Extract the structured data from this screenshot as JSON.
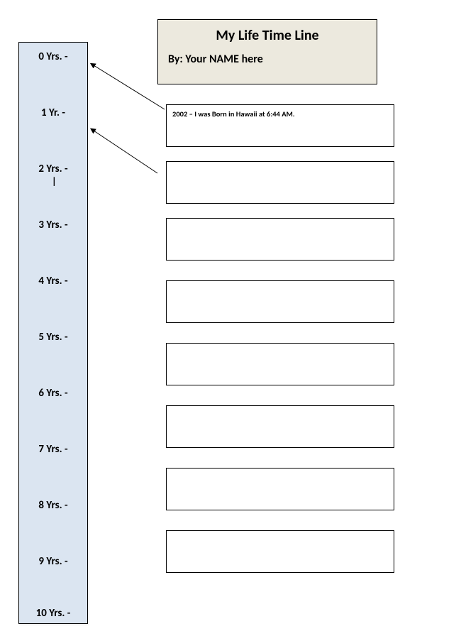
{
  "title": "My Life Time Line",
  "byline": "By:  Your NAME here",
  "years": {
    "y0": "0 Yrs. -",
    "y1": "1 Yr. -",
    "y2": "2 Yrs. -",
    "y3": "3 Yrs. -",
    "y4": "4 Yrs. -",
    "y5": "5 Yrs. -",
    "y6": "6 Yrs. -",
    "y7": "7 Yrs. -",
    "y8": "8 Yrs. -",
    "y9": "9 Yrs.  -",
    "y10": "10 Yrs. -"
  },
  "cursor": "|",
  "events": {
    "e1": "2002 – I was Born in Hawaii at 6:44 AM.",
    "e2": "",
    "e3": "",
    "e4": "",
    "e5": "",
    "e6": "",
    "e7": "",
    "e8": ""
  }
}
